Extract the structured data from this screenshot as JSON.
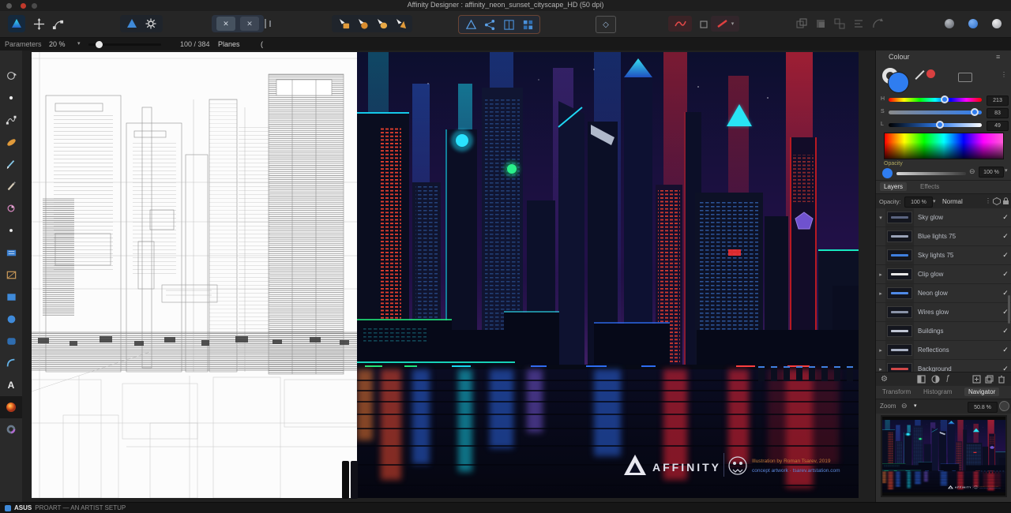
{
  "window": {
    "title": "Affinity Designer : affinity_neon_sunset_cityscape_HD (50 dpi)"
  },
  "context_bar": {
    "label": "Parameters",
    "percent": "20 %",
    "counter": "100 / 384",
    "mode": "Planes",
    "bracket": "("
  },
  "glyphs": {
    "check": "✓",
    "caret_down": "▾",
    "caret_right": "▸",
    "dots": "⋮",
    "burger": "≡",
    "minus_circle": "⊖",
    "close": "✕",
    "diamond": "◇",
    "text_tool": "A"
  },
  "colour_panel": {
    "title": "Colour",
    "sliders": [
      {
        "label": "H",
        "value": "213",
        "pos": 60
      },
      {
        "label": "S",
        "value": "83",
        "pos": 92
      },
      {
        "label": "L",
        "value": "49",
        "pos": 55
      }
    ],
    "opacity_label": "Opacity",
    "opacity_value": "100 %"
  },
  "layers_panel": {
    "tab_layers": "Layers",
    "tab_effects": "Effects",
    "opacity_label": "Opacity:",
    "opacity_value": "100 %",
    "blend_mode": "Normal",
    "layers": [
      {
        "arrow": "▾",
        "name": "Sky glow",
        "strip": "#5a6480"
      },
      {
        "arrow": "",
        "name": "Blue lights 75",
        "strip": "#9aa3b8"
      },
      {
        "arrow": "",
        "name": "Sky lights 75",
        "strip": "#3f7fe0"
      },
      {
        "arrow": "▸",
        "name": "Clip glow",
        "strip": "#e8e8e8"
      },
      {
        "arrow": "▸",
        "name": "Neon glow",
        "strip": "#4f8ae8"
      },
      {
        "arrow": "",
        "name": "Wires glow",
        "strip": "#8a93a8"
      },
      {
        "arrow": "",
        "name": "Buildings",
        "strip": "#c0c6d4"
      },
      {
        "arrow": "▸",
        "name": "Reflections",
        "strip": "#aab2c4"
      },
      {
        "arrow": "▸",
        "name": "Background",
        "strip": "#d04848"
      }
    ]
  },
  "panel_tabs": {
    "transform": "Transform",
    "histogram": "Histogram",
    "navigator": "Navigator"
  },
  "navigator": {
    "zoom_label": "Zoom",
    "zoom_value": "50.8 %"
  },
  "artwork": {
    "brand": "AFFINITY",
    "credit1": "Illustration by Roman Tsarev, 2019",
    "credit2": "concept artwork · tsarev.artstation.com"
  },
  "status": {
    "tool": "ASUS",
    "hint": "PROART — AN ARTIST SETUP"
  },
  "colors": {
    "accent_blue": "#2f7df0",
    "neon_cyan": "#28e4f4",
    "neon_red": "#ff3524",
    "neon_green": "#1fe87a"
  }
}
